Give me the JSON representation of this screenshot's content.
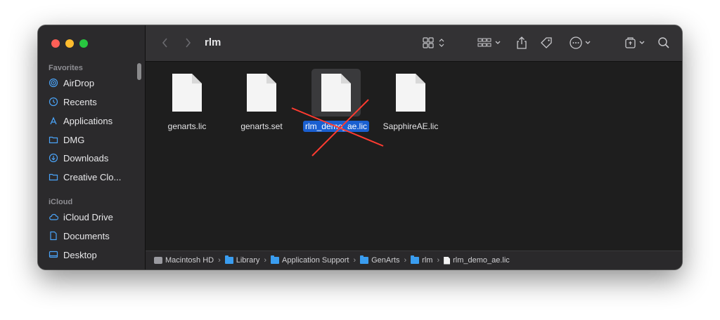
{
  "window": {
    "title": "rlm"
  },
  "sidebar": {
    "sections": [
      {
        "header": "Favorites"
      },
      {
        "header": "iCloud"
      }
    ],
    "favorites": [
      {
        "label": "AirDrop",
        "icon": "airdrop-icon"
      },
      {
        "label": "Recents",
        "icon": "clock-icon"
      },
      {
        "label": "Applications",
        "icon": "applications-icon"
      },
      {
        "label": "DMG",
        "icon": "folder-icon"
      },
      {
        "label": "Downloads",
        "icon": "download-icon"
      },
      {
        "label": "Creative Clo...",
        "icon": "folder-icon"
      }
    ],
    "icloud": [
      {
        "label": "iCloud Drive",
        "icon": "cloud-icon"
      },
      {
        "label": "Documents",
        "icon": "document-icon"
      },
      {
        "label": "Desktop",
        "icon": "desktop-icon"
      }
    ]
  },
  "files": [
    {
      "name": "genarts.lic",
      "selected": false
    },
    {
      "name": "genarts.set",
      "selected": false
    },
    {
      "name": "rlm_demo_ae.lic",
      "selected": true
    },
    {
      "name": "SapphireAE.lic",
      "selected": false
    }
  ],
  "pathbar": [
    {
      "label": "Macintosh HD",
      "icon": "hard-drive-icon"
    },
    {
      "label": "Library",
      "icon": "folder-icon"
    },
    {
      "label": "Application Support",
      "icon": "folder-icon"
    },
    {
      "label": "GenArts",
      "icon": "folder-icon"
    },
    {
      "label": "rlm",
      "icon": "folder-icon"
    },
    {
      "label": "rlm_demo_ae.lic",
      "icon": "document-icon"
    }
  ],
  "colors": {
    "accent": "#1a5fd0",
    "annotation": "#ff3b30",
    "sidebar_icon": "#4aa3f7"
  }
}
